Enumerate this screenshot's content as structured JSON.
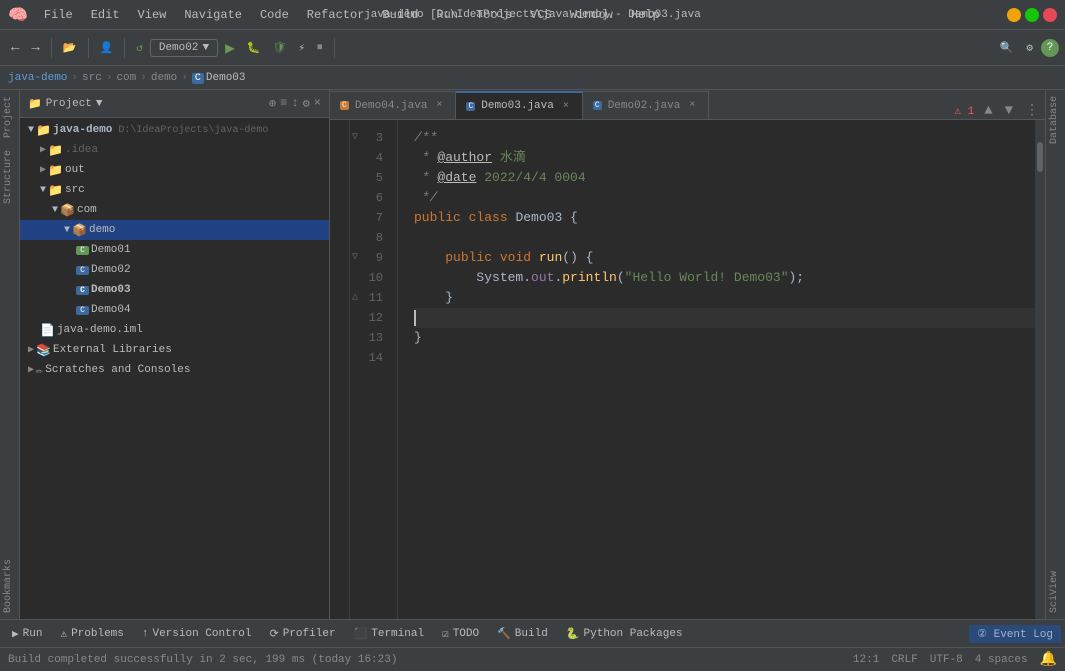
{
  "titleBar": {
    "title": "java-demo [D:\\IdeaProjects\\java-demo] - Demo03.java",
    "menus": [
      "File",
      "Edit",
      "View",
      "Navigate",
      "Code",
      "Refactor",
      "Build",
      "Run",
      "Tools",
      "VCS",
      "Window",
      "Help"
    ]
  },
  "toolbar": {
    "runConfig": "Demo02",
    "runLabel": "▶",
    "debugLabel": "🐛"
  },
  "breadcrumb": {
    "items": [
      "java-demo",
      "src",
      "com",
      "demo",
      "Demo03"
    ]
  },
  "tabs": [
    {
      "name": "Demo04.java",
      "active": false,
      "type": "orange"
    },
    {
      "name": "Demo03.java",
      "active": true,
      "type": "blue"
    },
    {
      "name": "Demo02.java",
      "active": false,
      "type": "blue"
    }
  ],
  "errorIndicator": "⚠ 1",
  "fileTree": {
    "items": [
      {
        "indent": 0,
        "icon": "folder",
        "label": "Project ▼",
        "type": "panel"
      },
      {
        "indent": 1,
        "icon": "project",
        "label": "java-demo  D:\\IdeaProjects\\java-demo",
        "type": "project"
      },
      {
        "indent": 2,
        "icon": "folder",
        "label": ".idea",
        "type": "folder"
      },
      {
        "indent": 2,
        "icon": "folder",
        "label": "out",
        "type": "folder"
      },
      {
        "indent": 2,
        "icon": "folder",
        "label": "src",
        "type": "folder-open"
      },
      {
        "indent": 3,
        "icon": "folder",
        "label": "com",
        "type": "folder-open"
      },
      {
        "indent": 4,
        "icon": "folder",
        "label": "demo",
        "type": "folder-open",
        "selected": true
      },
      {
        "indent": 5,
        "icon": "java",
        "label": "Demo01",
        "type": "java"
      },
      {
        "indent": 5,
        "icon": "java",
        "label": "Demo02",
        "type": "java"
      },
      {
        "indent": 5,
        "icon": "java",
        "label": "Demo03",
        "type": "java",
        "active": true
      },
      {
        "indent": 5,
        "icon": "java",
        "label": "Demo04",
        "type": "java"
      },
      {
        "indent": 2,
        "icon": "iml",
        "label": "java-demo.iml",
        "type": "iml"
      },
      {
        "indent": 1,
        "icon": "folder",
        "label": "External Libraries",
        "type": "folder"
      },
      {
        "indent": 1,
        "icon": "folder",
        "label": "Scratches and Consoles",
        "type": "folder"
      }
    ]
  },
  "codeLines": [
    {
      "num": 3,
      "content": "/**",
      "type": "comment",
      "hasFold": true
    },
    {
      "num": 4,
      "content": " * @author 水滴",
      "type": "comment",
      "annotation": "@author"
    },
    {
      "num": 5,
      "content": " * @date 2022/4/4 0004",
      "type": "comment",
      "annotation": "@date"
    },
    {
      "num": 6,
      "content": " */",
      "type": "comment",
      "hasFold": false
    },
    {
      "num": 7,
      "content": "public class Demo03 {",
      "type": "code"
    },
    {
      "num": 8,
      "content": "",
      "type": "blank"
    },
    {
      "num": 9,
      "content": "    public void run() {",
      "type": "code",
      "hasFold": true
    },
    {
      "num": 10,
      "content": "        System.out.println(\"Hello World! Demo03\");",
      "type": "code"
    },
    {
      "num": 11,
      "content": "    }",
      "type": "code",
      "hasFold": false
    },
    {
      "num": 12,
      "content": "",
      "type": "cursor"
    },
    {
      "num": 13,
      "content": "}",
      "type": "code"
    },
    {
      "num": 14,
      "content": "",
      "type": "blank"
    }
  ],
  "statusBar": {
    "message": "Build completed successfully in 2 sec, 199 ms (today 16:23)",
    "position": "12:1",
    "lineEnding": "CRLF",
    "encoding": "UTF-8",
    "indent": "4 spaces"
  },
  "bottomToolbar": {
    "buttons": [
      {
        "id": "run",
        "icon": "▶",
        "label": "Run"
      },
      {
        "id": "problems",
        "icon": "⚠",
        "label": "Problems"
      },
      {
        "id": "vcs",
        "icon": "↑",
        "label": "Version Control"
      },
      {
        "id": "profiler",
        "icon": "📊",
        "label": "Profiler"
      },
      {
        "id": "terminal",
        "icon": "⬛",
        "label": "Terminal"
      },
      {
        "id": "todo",
        "icon": "☑",
        "label": "TODO"
      },
      {
        "id": "build",
        "icon": "🔨",
        "label": "Build"
      },
      {
        "id": "python",
        "icon": "🐍",
        "label": "Python Packages"
      }
    ],
    "eventLog": "② Event Log"
  },
  "sideLabels": {
    "left": [
      "Project",
      "Structure",
      "Bookmarks"
    ],
    "right": [
      "Database",
      "SciView"
    ]
  }
}
